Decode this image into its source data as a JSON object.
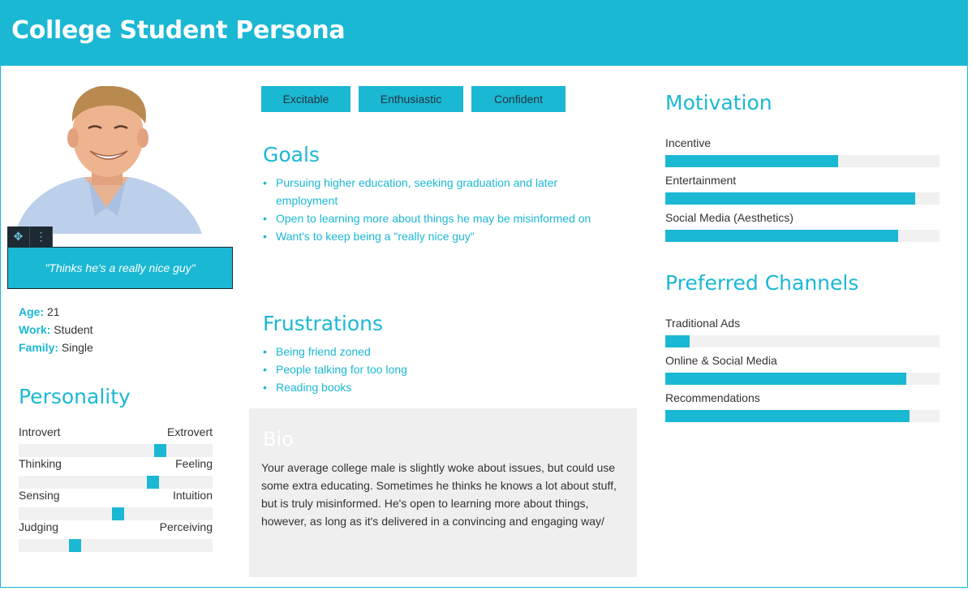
{
  "header": {
    "title": "College Student Persona"
  },
  "profile": {
    "quote": "\"Thinks he's a really nice guy\"",
    "facts": [
      {
        "key": "Age:",
        "value": " 21"
      },
      {
        "key": "Work:",
        "value": " Student"
      },
      {
        "key": "Family:",
        "value": " Single"
      }
    ]
  },
  "personality": {
    "title": "Personality",
    "traits": [
      {
        "left": "Introvert",
        "right": "Extrovert",
        "level": 0.73
      },
      {
        "left": "Thinking",
        "right": "Feeling",
        "level": 0.69
      },
      {
        "left": "Sensing",
        "right": "Intuition",
        "level": 0.51
      },
      {
        "left": "Judging",
        "right": "Perceiving",
        "level": 0.29
      }
    ]
  },
  "tags": [
    "Excitable",
    "Enthusiastic",
    "Confident"
  ],
  "goals": {
    "title": "Goals",
    "items": [
      "Pursuing higher education, seeking graduation and later employment",
      "Open to learning more about things he may be misinformed on",
      "Want's to keep being a \"really nice guy\""
    ]
  },
  "frustrations": {
    "title": "Frustrations",
    "items": [
      "Being friend zoned",
      "People talking for too long",
      "Reading books"
    ]
  },
  "bio": {
    "title": "Bio",
    "text": "Your average college male is slightly woke about issues, but could use some extra educating. Sometimes he thinks he knows a lot about stuff, but is truly misinformed. He's open to learning more about things, however, as long as it's delivered in a convincing and engaging way/"
  },
  "motivation": {
    "title": "Motivation",
    "items": [
      {
        "label": "Incentive",
        "level": 0.63
      },
      {
        "label": "Entertainment",
        "level": 0.91
      },
      {
        "label": "Social Media (Aesthetics)",
        "level": 0.85
      }
    ]
  },
  "channels": {
    "title": "Preferred Channels",
    "items": [
      {
        "label": "Traditional Ads",
        "level": 0.09
      },
      {
        "label": "Online & Social Media",
        "level": 0.88
      },
      {
        "label": "Recommendations",
        "level": 0.89
      }
    ]
  },
  "colors": {
    "accent": "#1bb8d4",
    "panel": "#efefef",
    "track": "#f1f1f1"
  },
  "icons": [
    "move-icon",
    "more-vertical-icon"
  ]
}
